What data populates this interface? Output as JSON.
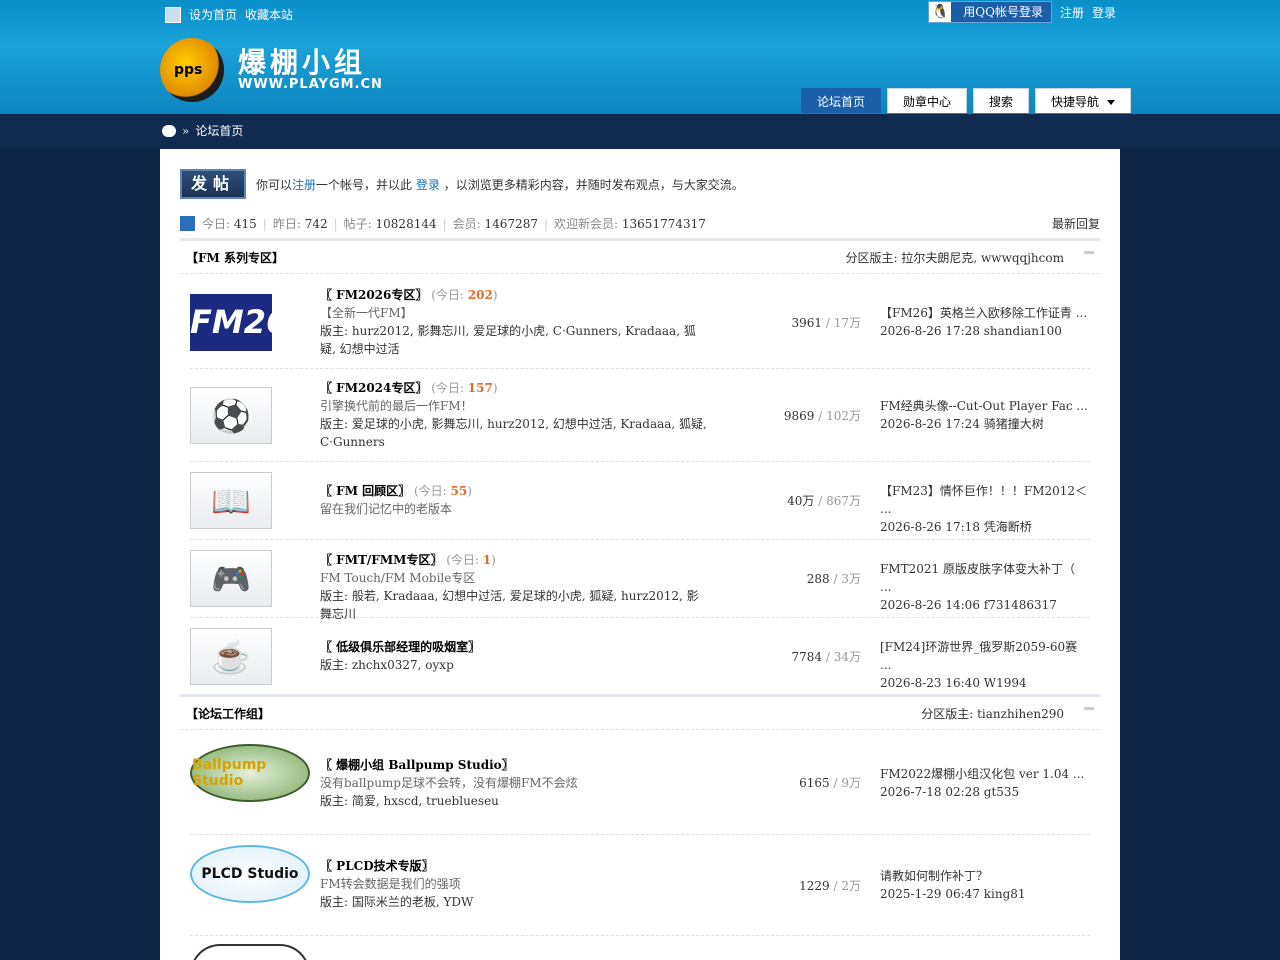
{
  "header": {
    "toplinks": [
      "设为首页",
      "收藏本站"
    ],
    "qq_login": "用QQ帐号登录",
    "register": "注册",
    "login": "登录",
    "logo_title": "爆棚小组",
    "logo_url": "WWW.PLAYGM.CN",
    "logo_ball": "pps",
    "nav": [
      "论坛首页",
      "勋章中心",
      "搜索",
      "快捷导航"
    ],
    "breadcrumb_sep": "»",
    "breadcrumb": "论坛首页"
  },
  "post": {
    "button": "发帖",
    "msg_prefix": "你可以",
    "msg_register": "注册",
    "msg_mid": "一个帐号，并以此",
    "msg_login": "登录",
    "msg_suffix": "，以浏览更多精彩内容，并随时发布观点，与大家交流。"
  },
  "stats": {
    "today_label": "今日:",
    "today": "415",
    "yesterday_label": "昨日:",
    "yesterday": "742",
    "posts_label": "帖子:",
    "posts": "10828144",
    "members_label": "会员:",
    "members": "1467287",
    "newest_label": "欢迎新会员:",
    "newest": "13651774317",
    "latest_reply": "最新回复"
  },
  "categories": [
    {
      "title": "【FM 系列专区】",
      "mods": "分区版主: 拉尔夫朗尼克, wwwqqjhcom",
      "forums": [
        {
          "name": "〖 FM2026专区〗",
          "today_label": "(今日: ",
          "today": "202",
          "today_end": ")",
          "desc": "【全新一代FM】",
          "mods": "版主: hurz2012, 影舞忘川, 爱足球的小虎, C·Gunners, Kradaaa, 狐疑, 幻想中过活",
          "count": "3961",
          "total": " / 17万",
          "last_title": "【FM26】英格兰入欧移除工作证青 ...",
          "last_meta": "2026-8-26 17:28 shandian100",
          "icon": "FM26"
        },
        {
          "name": "〖 FM2024专区〗",
          "today_label": "(今日: ",
          "today": "157",
          "today_end": ")",
          "desc": "引擎换代前的最后一作FM！",
          "mods": "版主: 爱足球的小虎, 影舞忘川, hurz2012, 幻想中过活, Kradaaa, 狐疑, C·Gunners",
          "count": "9869",
          "total": " / 102万",
          "last_title": "FM经典头像--Cut-Out Player Fac ...",
          "last_meta": "2026-8-26 17:24 骑猪撞大树",
          "icon": "⚽"
        },
        {
          "name": "〖 FM 回顾区〗",
          "today_label": "(今日: ",
          "today": "55",
          "today_end": ")",
          "desc": "留在我们记忆中的老版本",
          "mods": "",
          "count": "40万",
          "total": " / 867万",
          "last_title": "【FM23】情怀巨作！！！FM2012＜ ...",
          "last_meta": "2026-8-26 17:18 凭海断桥",
          "icon": "📖"
        },
        {
          "name": "〖 FMT/FMM专区〗",
          "today_label": "(今日: ",
          "today": "1",
          "today_end": ")",
          "desc": "FM Touch/FM Mobile专区",
          "mods": "版主: 般若, Kradaaa, 幻想中过活, 爱足球的小虎, 狐疑, hurz2012, 影舞忘川",
          "count": "288",
          "total": " / 3万",
          "last_title": "FMT2021 原版皮肤字体变大补丁（ ...",
          "last_meta": "2026-8-26 14:06 f731486317",
          "icon": "🎮"
        },
        {
          "name": "〖 低级俱乐部经理的吸烟室〗",
          "today_label": "",
          "today": "",
          "today_end": "",
          "desc": "",
          "mods": "版主: zhchx0327, oyxp",
          "count": "7784",
          "total": " / 34万",
          "last_title": "[FM24]环游世界_俄罗斯2059-60赛 ...",
          "last_meta": "2026-8-23 16:40 W1994",
          "icon": "☕"
        }
      ]
    },
    {
      "title": "【论坛工作组】",
      "mods": "分区版主: tianzhihen290",
      "forums": [
        {
          "name": "〖 爆棚小组 Ballpump Studio〗",
          "desc": "没有ballpump足球不会转，没有爆棚FM不会炫",
          "mods": "版主: 简爱, hxscd, trueblueseu",
          "count": "6165",
          "total": " / 9万",
          "last_title": "FM2022爆棚小组汉化包 ver 1.04 ...",
          "last_meta": "2026-7-18 02:28 gt535",
          "icon": "Ballpump Studio"
        },
        {
          "name": "〖 PLCD技术专版〗",
          "desc": "FM转会数据是我们的强项",
          "mods": "版主: 国际米兰的老板, YDW",
          "count": "1229",
          "total": " / 2万",
          "last_title": "请教如何制作补丁？",
          "last_meta": "2025-1-29 06:47 king81",
          "icon": "PLCD Studio"
        }
      ]
    }
  ]
}
